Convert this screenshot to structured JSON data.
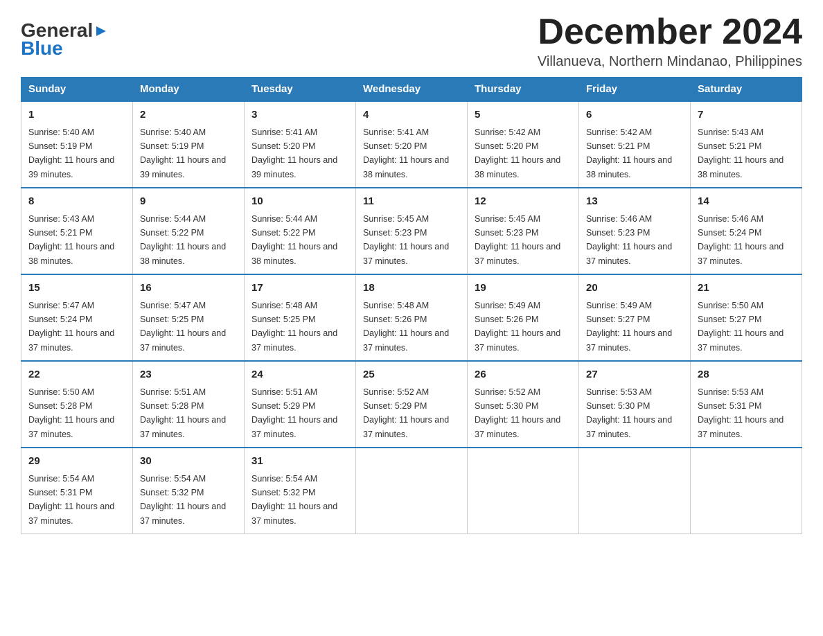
{
  "logo": {
    "general": "General",
    "blue": "Blue",
    "triangle_char": "▶"
  },
  "title": "December 2024",
  "subtitle": "Villanueva, Northern Mindanao, Philippines",
  "days_header": [
    "Sunday",
    "Monday",
    "Tuesday",
    "Wednesday",
    "Thursday",
    "Friday",
    "Saturday"
  ],
  "weeks": [
    [
      {
        "day": "1",
        "sunrise": "Sunrise: 5:40 AM",
        "sunset": "Sunset: 5:19 PM",
        "daylight": "Daylight: 11 hours and 39 minutes."
      },
      {
        "day": "2",
        "sunrise": "Sunrise: 5:40 AM",
        "sunset": "Sunset: 5:19 PM",
        "daylight": "Daylight: 11 hours and 39 minutes."
      },
      {
        "day": "3",
        "sunrise": "Sunrise: 5:41 AM",
        "sunset": "Sunset: 5:20 PM",
        "daylight": "Daylight: 11 hours and 39 minutes."
      },
      {
        "day": "4",
        "sunrise": "Sunrise: 5:41 AM",
        "sunset": "Sunset: 5:20 PM",
        "daylight": "Daylight: 11 hours and 38 minutes."
      },
      {
        "day": "5",
        "sunrise": "Sunrise: 5:42 AM",
        "sunset": "Sunset: 5:20 PM",
        "daylight": "Daylight: 11 hours and 38 minutes."
      },
      {
        "day": "6",
        "sunrise": "Sunrise: 5:42 AM",
        "sunset": "Sunset: 5:21 PM",
        "daylight": "Daylight: 11 hours and 38 minutes."
      },
      {
        "day": "7",
        "sunrise": "Sunrise: 5:43 AM",
        "sunset": "Sunset: 5:21 PM",
        "daylight": "Daylight: 11 hours and 38 minutes."
      }
    ],
    [
      {
        "day": "8",
        "sunrise": "Sunrise: 5:43 AM",
        "sunset": "Sunset: 5:21 PM",
        "daylight": "Daylight: 11 hours and 38 minutes."
      },
      {
        "day": "9",
        "sunrise": "Sunrise: 5:44 AM",
        "sunset": "Sunset: 5:22 PM",
        "daylight": "Daylight: 11 hours and 38 minutes."
      },
      {
        "day": "10",
        "sunrise": "Sunrise: 5:44 AM",
        "sunset": "Sunset: 5:22 PM",
        "daylight": "Daylight: 11 hours and 38 minutes."
      },
      {
        "day": "11",
        "sunrise": "Sunrise: 5:45 AM",
        "sunset": "Sunset: 5:23 PM",
        "daylight": "Daylight: 11 hours and 37 minutes."
      },
      {
        "day": "12",
        "sunrise": "Sunrise: 5:45 AM",
        "sunset": "Sunset: 5:23 PM",
        "daylight": "Daylight: 11 hours and 37 minutes."
      },
      {
        "day": "13",
        "sunrise": "Sunrise: 5:46 AM",
        "sunset": "Sunset: 5:23 PM",
        "daylight": "Daylight: 11 hours and 37 minutes."
      },
      {
        "day": "14",
        "sunrise": "Sunrise: 5:46 AM",
        "sunset": "Sunset: 5:24 PM",
        "daylight": "Daylight: 11 hours and 37 minutes."
      }
    ],
    [
      {
        "day": "15",
        "sunrise": "Sunrise: 5:47 AM",
        "sunset": "Sunset: 5:24 PM",
        "daylight": "Daylight: 11 hours and 37 minutes."
      },
      {
        "day": "16",
        "sunrise": "Sunrise: 5:47 AM",
        "sunset": "Sunset: 5:25 PM",
        "daylight": "Daylight: 11 hours and 37 minutes."
      },
      {
        "day": "17",
        "sunrise": "Sunrise: 5:48 AM",
        "sunset": "Sunset: 5:25 PM",
        "daylight": "Daylight: 11 hours and 37 minutes."
      },
      {
        "day": "18",
        "sunrise": "Sunrise: 5:48 AM",
        "sunset": "Sunset: 5:26 PM",
        "daylight": "Daylight: 11 hours and 37 minutes."
      },
      {
        "day": "19",
        "sunrise": "Sunrise: 5:49 AM",
        "sunset": "Sunset: 5:26 PM",
        "daylight": "Daylight: 11 hours and 37 minutes."
      },
      {
        "day": "20",
        "sunrise": "Sunrise: 5:49 AM",
        "sunset": "Sunset: 5:27 PM",
        "daylight": "Daylight: 11 hours and 37 minutes."
      },
      {
        "day": "21",
        "sunrise": "Sunrise: 5:50 AM",
        "sunset": "Sunset: 5:27 PM",
        "daylight": "Daylight: 11 hours and 37 minutes."
      }
    ],
    [
      {
        "day": "22",
        "sunrise": "Sunrise: 5:50 AM",
        "sunset": "Sunset: 5:28 PM",
        "daylight": "Daylight: 11 hours and 37 minutes."
      },
      {
        "day": "23",
        "sunrise": "Sunrise: 5:51 AM",
        "sunset": "Sunset: 5:28 PM",
        "daylight": "Daylight: 11 hours and 37 minutes."
      },
      {
        "day": "24",
        "sunrise": "Sunrise: 5:51 AM",
        "sunset": "Sunset: 5:29 PM",
        "daylight": "Daylight: 11 hours and 37 minutes."
      },
      {
        "day": "25",
        "sunrise": "Sunrise: 5:52 AM",
        "sunset": "Sunset: 5:29 PM",
        "daylight": "Daylight: 11 hours and 37 minutes."
      },
      {
        "day": "26",
        "sunrise": "Sunrise: 5:52 AM",
        "sunset": "Sunset: 5:30 PM",
        "daylight": "Daylight: 11 hours and 37 minutes."
      },
      {
        "day": "27",
        "sunrise": "Sunrise: 5:53 AM",
        "sunset": "Sunset: 5:30 PM",
        "daylight": "Daylight: 11 hours and 37 minutes."
      },
      {
        "day": "28",
        "sunrise": "Sunrise: 5:53 AM",
        "sunset": "Sunset: 5:31 PM",
        "daylight": "Daylight: 11 hours and 37 minutes."
      }
    ],
    [
      {
        "day": "29",
        "sunrise": "Sunrise: 5:54 AM",
        "sunset": "Sunset: 5:31 PM",
        "daylight": "Daylight: 11 hours and 37 minutes."
      },
      {
        "day": "30",
        "sunrise": "Sunrise: 5:54 AM",
        "sunset": "Sunset: 5:32 PM",
        "daylight": "Daylight: 11 hours and 37 minutes."
      },
      {
        "day": "31",
        "sunrise": "Sunrise: 5:54 AM",
        "sunset": "Sunset: 5:32 PM",
        "daylight": "Daylight: 11 hours and 37 minutes."
      },
      null,
      null,
      null,
      null
    ]
  ]
}
